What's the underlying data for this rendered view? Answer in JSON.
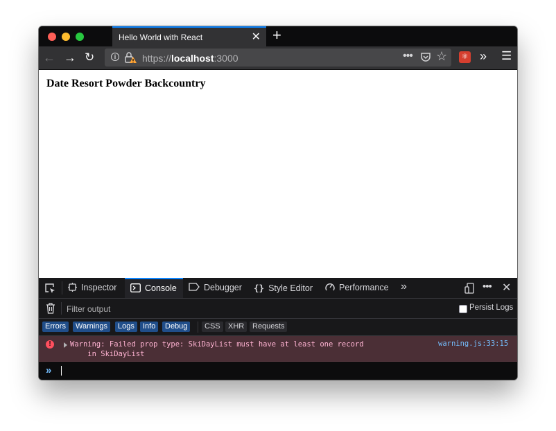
{
  "browser": {
    "tab_title": "Hello World with React",
    "url_scheme": "https://",
    "url_host": "localhost",
    "url_port": ":3000",
    "accent": "#0a84ff"
  },
  "page": {
    "heading": "Date Resort Powder Backcountry"
  },
  "devtools": {
    "tabs": [
      {
        "label": "Inspector",
        "icon": "inspector-icon"
      },
      {
        "label": "Console",
        "icon": "console-icon"
      },
      {
        "label": "Debugger",
        "icon": "debugger-icon"
      },
      {
        "label": "Style Editor",
        "icon": "style-editor-icon"
      },
      {
        "label": "Performance",
        "icon": "performance-icon"
      }
    ],
    "active_tab": "Console",
    "filter_placeholder": "Filter output",
    "persist_logs_label": "Persist Logs",
    "levels": [
      "Errors",
      "Warnings",
      "Logs",
      "Info",
      "Debug"
    ],
    "request_filters": [
      "CSS",
      "XHR",
      "Requests"
    ],
    "message": {
      "text": "Warning: Failed prop type: SkiDayList must have at least one record\n    in SkiDayList",
      "source": "warning.js:33:15",
      "level": "error"
    }
  }
}
